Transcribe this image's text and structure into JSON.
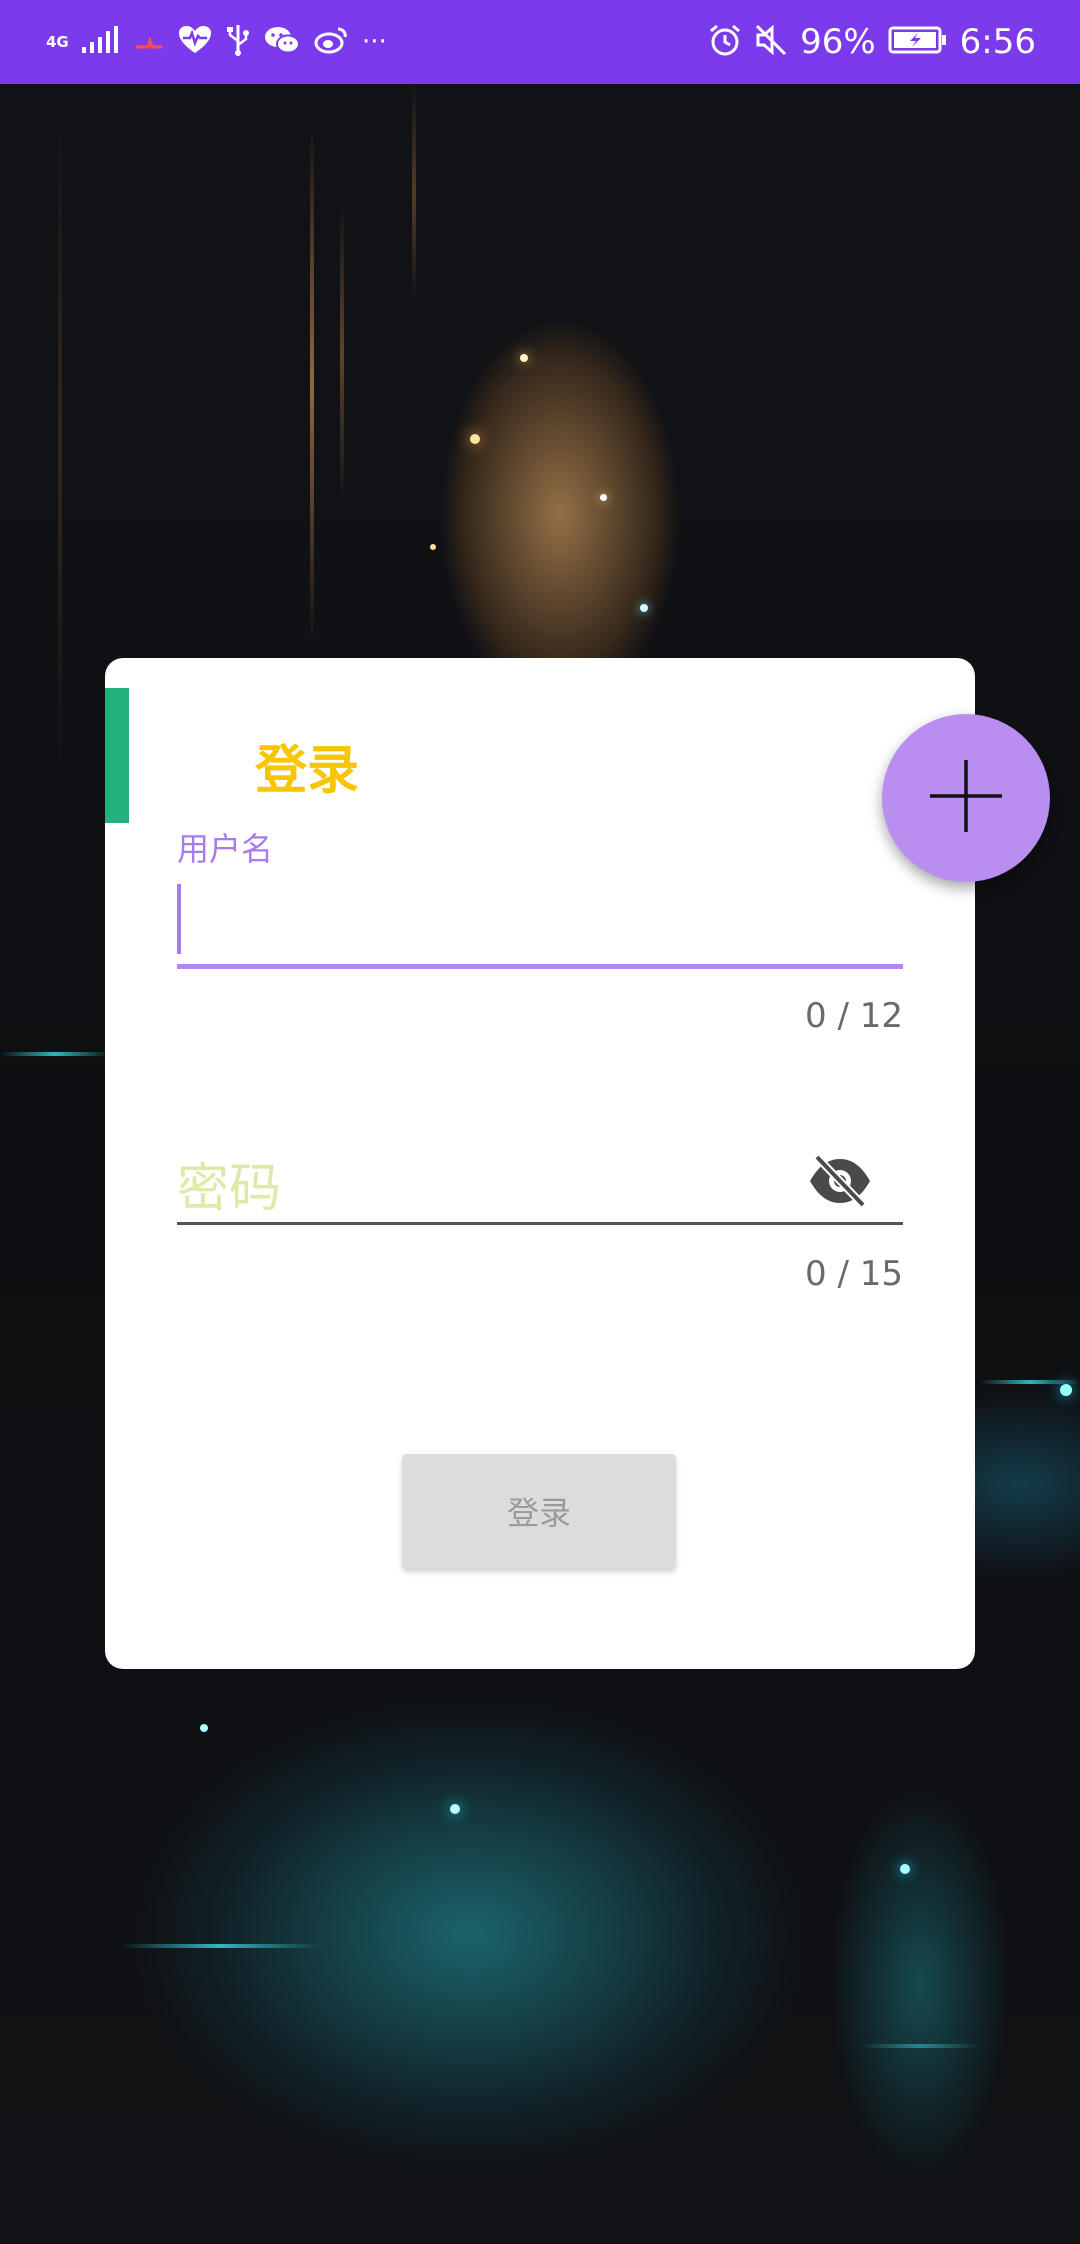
{
  "status_bar": {
    "network_label": "4G",
    "battery_percent": "96%",
    "time": "6:56",
    "more_glyph": "···",
    "icons": [
      "signal-icon",
      "heart-rate-icon",
      "usb-icon",
      "wechat-icon",
      "weibo-icon",
      "alarm-icon",
      "mute-icon",
      "battery-charging-icon"
    ]
  },
  "login_card": {
    "title": "登录",
    "username_label": "用户名",
    "username_value": "",
    "username_counter": "0 / 12",
    "password_placeholder": "密码",
    "password_counter": "0 / 15",
    "submit_label": "登录"
  },
  "fab": {
    "icon": "plus-icon"
  },
  "colors": {
    "status_bar": "#7c3aed",
    "title": "#f7c600",
    "accent_bar": "#22b07d",
    "input_focus": "#b388ee",
    "fab": "#b98ef0"
  }
}
